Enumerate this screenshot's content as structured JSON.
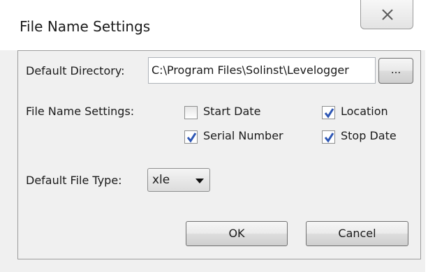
{
  "window": {
    "title": "File Name Settings",
    "close_glyph": "✕",
    "close_icon": "close-icon"
  },
  "directory": {
    "label": "Default Directory:",
    "value": "C:\\Program Files\\Solinst\\Levelogger",
    "browse_label": "..."
  },
  "file_name_settings": {
    "label": "File Name Settings:",
    "options": [
      {
        "label": "Start Date",
        "checked": false
      },
      {
        "label": "Location",
        "checked": true
      },
      {
        "label": "Serial Number",
        "checked": true
      },
      {
        "label": "Stop Date",
        "checked": true
      }
    ]
  },
  "file_type": {
    "label": "Default File Type:",
    "selected": "xle"
  },
  "buttons": {
    "ok": "OK",
    "cancel": "Cancel"
  },
  "colors": {
    "checkmark": "#2d56b4",
    "panel_border": "#9c9c9c",
    "window_bg": "#f0f0f0"
  }
}
